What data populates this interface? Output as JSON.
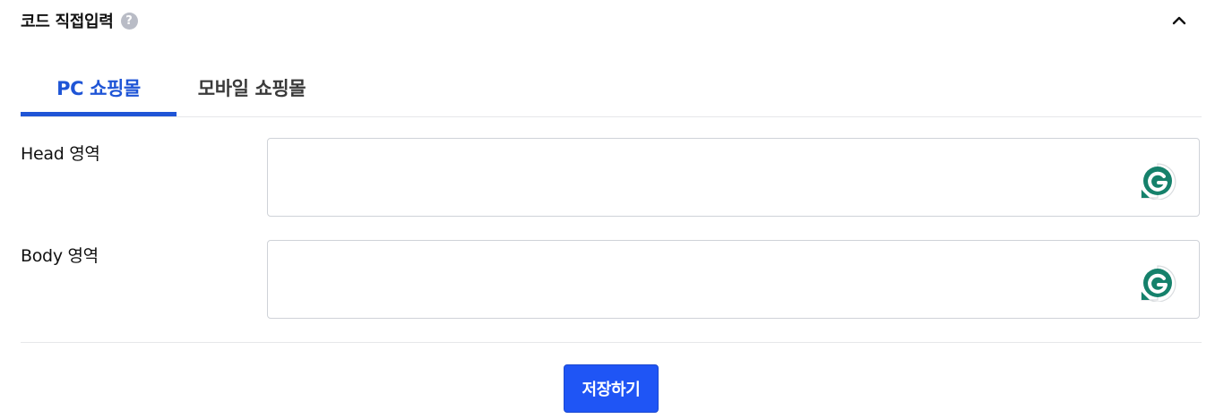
{
  "section": {
    "title": "코드 직접입력",
    "help_icon": "question-mark-icon",
    "help_glyph": "?",
    "toggle_icon": "chevron-up-icon"
  },
  "tabs": [
    {
      "label": "PC 쇼핑몰",
      "active": true
    },
    {
      "label": "모바일 쇼핑몰",
      "active": false
    }
  ],
  "fields": {
    "head": {
      "label": "Head 영역",
      "value": "",
      "badge_icon": "grammarly-icon"
    },
    "body": {
      "label": "Body 영역",
      "value": "",
      "badge_icon": "grammarly-icon"
    }
  },
  "actions": {
    "save_label": "저장하기"
  },
  "colors": {
    "accent": "#1f55d6",
    "button": "#1f55f5",
    "grammarly": "#15816b"
  }
}
